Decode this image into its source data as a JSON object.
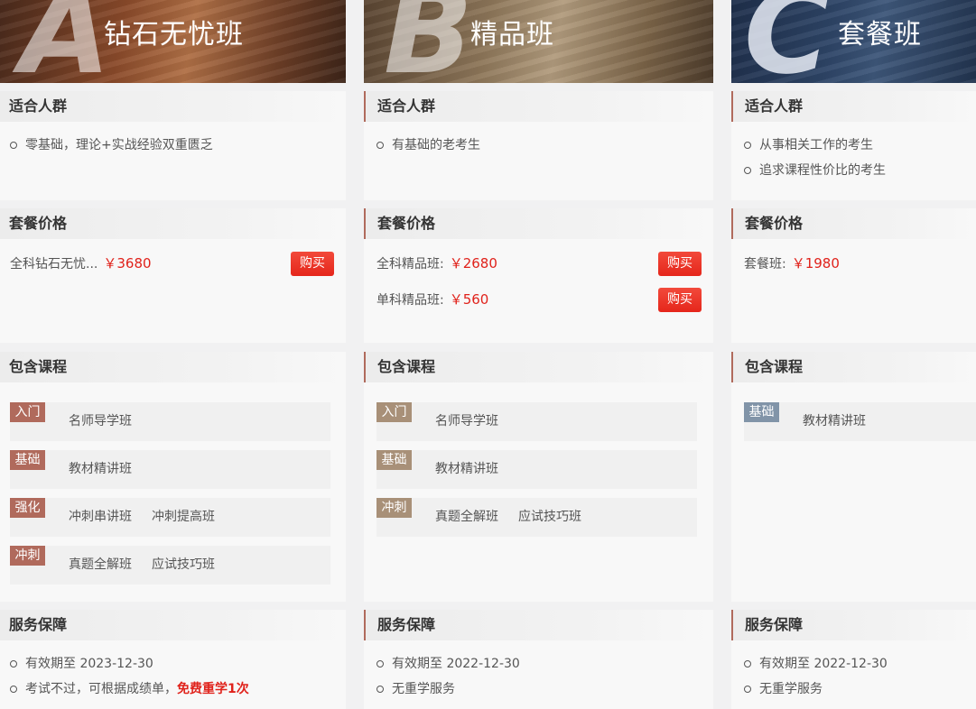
{
  "columns": [
    {
      "key": "a",
      "letter": "A",
      "title": "钻石无忧班",
      "audience_heading": "适合人群",
      "audience": [
        "零基础，理论+实战经验双重匮乏"
      ],
      "price_heading": "套餐价格",
      "prices": [
        {
          "label": "全科钻石无忧...",
          "amount": "￥3680",
          "buy_label": "购买"
        }
      ],
      "course_heading": "包含课程",
      "courses": [
        {
          "tag": "入门",
          "names": [
            "名师导学班"
          ]
        },
        {
          "tag": "基础",
          "names": [
            "教材精讲班"
          ]
        },
        {
          "tag": "强化",
          "names": [
            "冲刺串讲班",
            "冲刺提高班"
          ]
        },
        {
          "tag": "冲刺",
          "names": [
            "真题全解班",
            "应试技巧班"
          ]
        }
      ],
      "service_heading": "服务保障",
      "services": [
        {
          "text": "有效期至 2023-12-30",
          "highlight": ""
        },
        {
          "text": "考试不过，可根据成绩单，",
          "highlight": "免费重学1次"
        }
      ]
    },
    {
      "key": "b",
      "letter": "B",
      "title": "精品班",
      "audience_heading": "适合人群",
      "audience": [
        "有基础的老考生"
      ],
      "price_heading": "套餐价格",
      "prices": [
        {
          "label": "全科精品班:",
          "amount": "￥2680",
          "buy_label": "购买"
        },
        {
          "label": "单科精品班:",
          "amount": "￥560",
          "buy_label": "购买"
        }
      ],
      "course_heading": "包含课程",
      "courses": [
        {
          "tag": "入门",
          "names": [
            "名师导学班"
          ]
        },
        {
          "tag": "基础",
          "names": [
            "教材精讲班"
          ]
        },
        {
          "tag": "冲刺",
          "names": [
            "真题全解班",
            "应试技巧班"
          ]
        }
      ],
      "service_heading": "服务保障",
      "services": [
        {
          "text": "有效期至 2022-12-30",
          "highlight": ""
        },
        {
          "text": "无重学服务",
          "highlight": ""
        }
      ]
    },
    {
      "key": "c",
      "letter": "C",
      "title": "套餐班",
      "audience_heading": "适合人群",
      "audience": [
        "从事相关工作的考生",
        "追求课程性价比的考生"
      ],
      "price_heading": "套餐价格",
      "prices": [
        {
          "label": "套餐班:",
          "amount": "￥1980",
          "buy_label": ""
        }
      ],
      "course_heading": "包含课程",
      "courses": [
        {
          "tag": "基础",
          "names": [
            "教材精讲班"
          ]
        }
      ],
      "service_heading": "服务保障",
      "services": [
        {
          "text": "有效期至 2022-12-30",
          "highlight": ""
        },
        {
          "text": "无重学服务",
          "highlight": ""
        }
      ]
    }
  ]
}
